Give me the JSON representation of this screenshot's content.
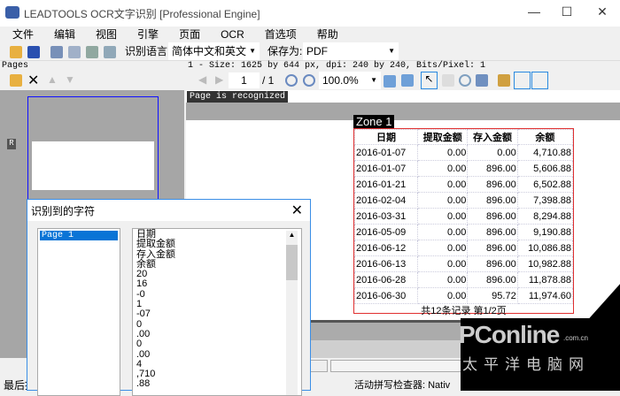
{
  "window": {
    "title": "LEADTOOLS OCR文字识别 [Professional Engine]"
  },
  "menu": [
    "文件",
    "编辑",
    "视图",
    "引擎",
    "页面",
    "OCR",
    "首选项",
    "帮助"
  ],
  "toolbar": {
    "lang_label": "识别语言:",
    "lang_value": "简体中文和英文",
    "save_label": "保存为:",
    "save_value": "PDF"
  },
  "pages_label": "Pages",
  "image_info": "1 - Size: 1625 by 644 px, dpi: 240 by 240, Bits/Pixel: 1",
  "nav": {
    "page": "1",
    "total": "/ 1",
    "zoom": "100.0%"
  },
  "thumb_badge": "R",
  "recognized_status": "Page is recognized",
  "zone": {
    "label": "Zone 1",
    "headers": [
      "日期",
      "提取金额",
      "存入金额",
      "余额"
    ],
    "rows": [
      [
        "2016-01-07",
        "0.00",
        "0.00",
        "4,710.88"
      ],
      [
        "2016-01-07",
        "0.00",
        "896.00",
        "5,606.88"
      ],
      [
        "2016-01-21",
        "0.00",
        "896.00",
        "6,502.88"
      ],
      [
        "2016-02-04",
        "0.00",
        "896.00",
        "7,398.88"
      ],
      [
        "2016-03-31",
        "0.00",
        "896.00",
        "8,294.88"
      ],
      [
        "2016-05-09",
        "0.00",
        "896.00",
        "9,190.88"
      ],
      [
        "2016-06-12",
        "0.00",
        "896.00",
        "10,086.88"
      ],
      [
        "2016-06-13",
        "0.00",
        "896.00",
        "10,982.88"
      ],
      [
        "2016-06-28",
        "0.00",
        "896.00",
        "11,878.88"
      ],
      [
        "2016-06-30",
        "0.00",
        "95.72",
        "11,974.60"
      ]
    ],
    "footer": "共12条记录 第1/2页"
  },
  "status": {
    "left": "最后提",
    "spell": "活动拼写检查器: Nativ"
  },
  "dialog": {
    "title": "识别到的字符",
    "pages": [
      "Page 1"
    ],
    "chars": [
      "日期",
      "提取金额",
      "存入金额",
      "余额",
      "20",
      "16",
      "-0",
      "1",
      "-07",
      "0",
      ".00",
      "0",
      ".00",
      "4",
      ",710",
      ".88"
    ]
  },
  "watermark": {
    "brand": "PConline",
    "domain": ".com.cn",
    "sub": "太平洋电脑网"
  }
}
